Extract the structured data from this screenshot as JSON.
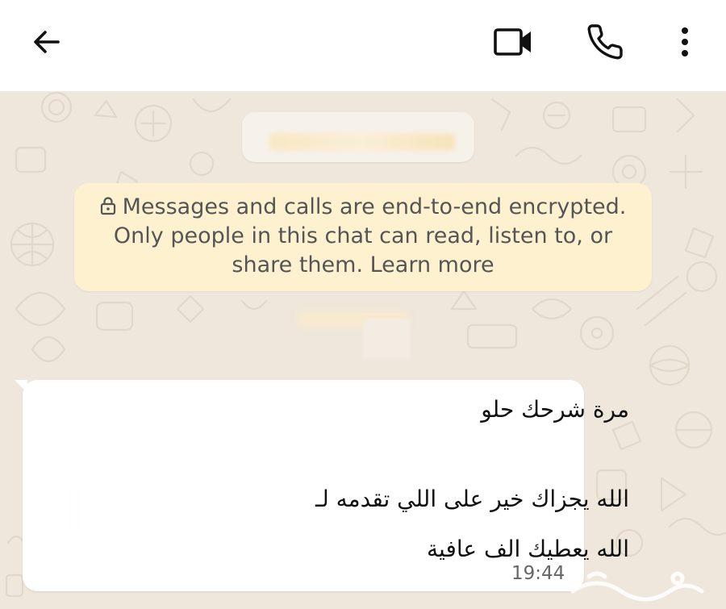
{
  "header": {
    "back_icon": "arrow-left-icon",
    "video_icon": "video-camera-icon",
    "call_icon": "phone-icon",
    "menu_icon": "more-vertical-icon"
  },
  "encryption_notice": {
    "line1": "Messages and calls are end-to-end encrypted.",
    "line2": "Only people in this chat can read, listen to, or",
    "line3": "share them. Learn more",
    "icon": "lock-icon"
  },
  "message": {
    "line1": "مرة شرحك حلو",
    "line2": "الله يجزاك خير على اللي تقدمه لـ",
    "line3": "الله يعطيك الف عافية",
    "time": "19:44"
  },
  "colors": {
    "chat_background": "#efe7dc",
    "notice_background": "#fdf1cf",
    "bubble_background": "#ffffff",
    "icon_color": "#111111"
  },
  "watermark_icon": "haraj-watermark-icon"
}
